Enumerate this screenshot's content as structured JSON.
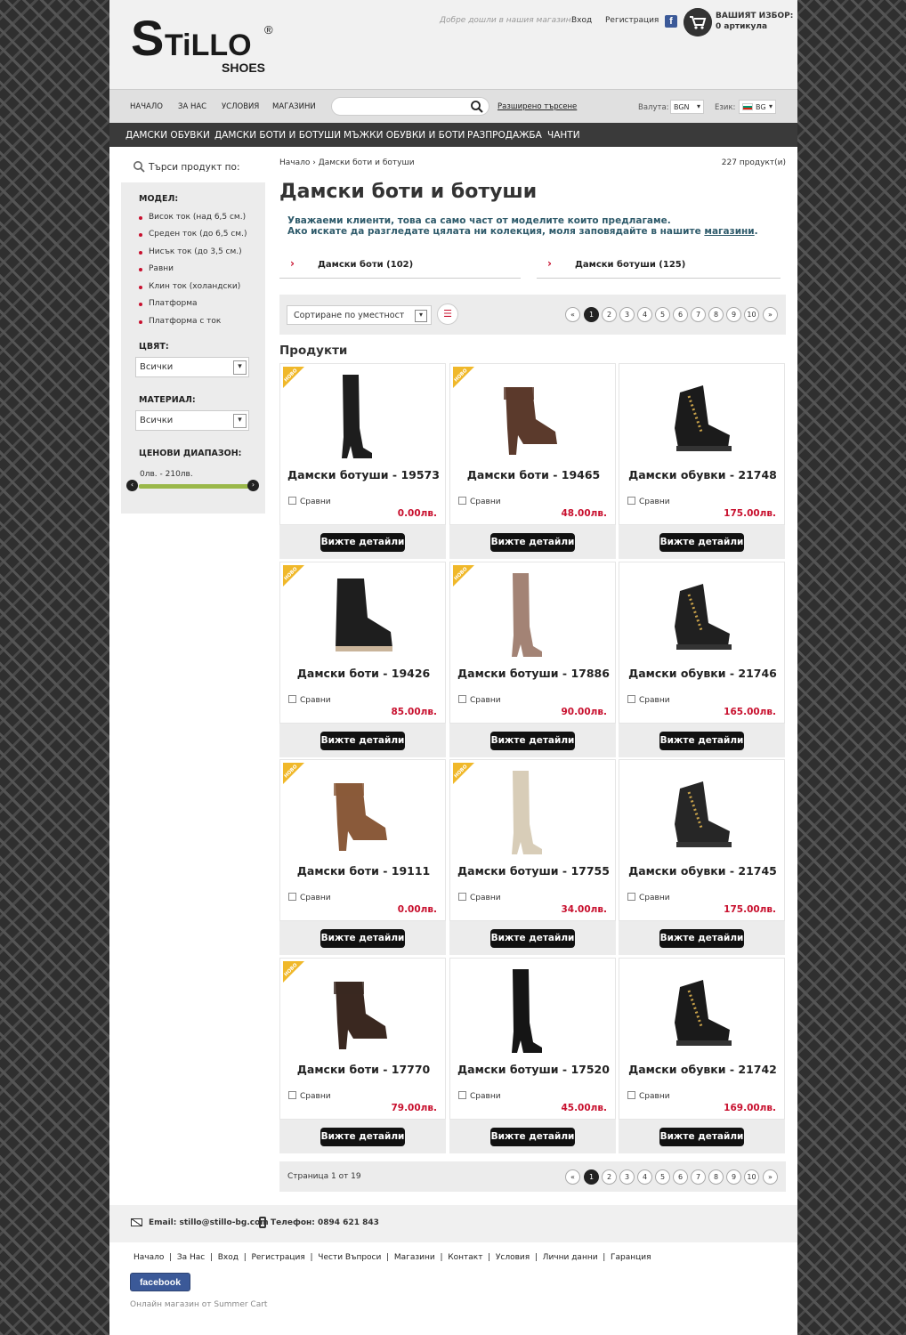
{
  "header": {
    "logo_main": "STiLLO",
    "logo_reg": "®",
    "logo_sub": "SHOES",
    "welcome": "Добре дошли в нашия магазин!",
    "login": "Вход",
    "register": "Регистрация",
    "facebook_letter": "f",
    "cart_title": "ВАШИЯТ ИЗБОР:",
    "cart_count": "0 артикула"
  },
  "nav": {
    "items": [
      "НАЧАЛО",
      "ЗА НАС",
      "УСЛОВИЯ",
      "МАГАЗИНИ"
    ],
    "search_placeholder": "",
    "advanced_search": "Разширено търсене",
    "currency_label": "Валута:",
    "currency_value": "BGN",
    "language_label": "Език:",
    "language_value": "BG"
  },
  "categories": [
    "ДАМСКИ ОБУВКИ",
    "ДАМСКИ БОТИ И БОТУШИ",
    "МЪЖКИ ОБУВКИ И БОТИ",
    "РАЗПРОДАЖБА",
    "ЧАНТИ"
  ],
  "sidebar": {
    "title": "Търси продукт по:",
    "model_label": "МОДЕЛ:",
    "models": [
      "Висок ток (над 6,5 см.)",
      "Среден ток (до 6,5 см.)",
      "Нисък ток (до 3,5 см.)",
      "Равни",
      "Клин ток (холандски)",
      "Платформа",
      "Платформа с ток"
    ],
    "color_label": "ЦВЯТ:",
    "color_value": "Всички",
    "material_label": "МАТЕРИАЛ:",
    "material_value": "Всички",
    "price_label": "ЦЕНОВИ ДИАПАЗОН:",
    "price_range": "0лв. - 210лв."
  },
  "main": {
    "breadcrumb": "Начало › Дамски боти и ботуши",
    "product_count": "227 продукт(и)",
    "title": "Дамски боти и ботуши",
    "intro_line1": "Уважаеми клиенти, това са само част от моделите които предлагаме.",
    "intro_line2": "Ако искате да разгледате цялата ни колекция, моля заповядайте в нашите ",
    "intro_link": "магазини",
    "intro_end": ".",
    "subcats": [
      "Дамски боти (102)",
      "Дамски ботуши (125)"
    ],
    "sort": "Сортиране по уместност",
    "pages": [
      "«",
      "1",
      "2",
      "3",
      "4",
      "5",
      "6",
      "7",
      "8",
      "9",
      "10",
      "»"
    ],
    "current_page": "1",
    "products_heading": "Продукти",
    "page_info": "Страница 1 от 19",
    "compare": "Сравни",
    "details": "Вижте детайли",
    "new_badge": "НОВО"
  },
  "products": [
    {
      "name": "Дамски ботуши - 19573",
      "price": "0.00лв.",
      "isNew": true,
      "shape": "tall",
      "color": "#1d1d1d"
    },
    {
      "name": "Дамски боти - 19465",
      "price": "48.00лв.",
      "isNew": true,
      "shape": "ankle",
      "color": "#5b3a2c"
    },
    {
      "name": "Дамски обувки - 21748",
      "price": "175.00лв.",
      "isNew": false,
      "shape": "sneaker",
      "color": "#1b1b1b"
    },
    {
      "name": "Дамски боти - 19426",
      "price": "85.00лв.",
      "isNew": true,
      "shape": "biker",
      "color": "#1e1e1e"
    },
    {
      "name": "Дамски ботуши - 17886",
      "price": "90.00лв.",
      "isNew": true,
      "shape": "tall",
      "color": "#a38375"
    },
    {
      "name": "Дамски обувки - 21746",
      "price": "165.00лв.",
      "isNew": false,
      "shape": "sneaker",
      "color": "#202020"
    },
    {
      "name": "Дамски боти - 19111",
      "price": "0.00лв.",
      "isNew": true,
      "shape": "ankle",
      "color": "#8a5a3a"
    },
    {
      "name": "Дамски ботуши - 17755",
      "price": "34.00лв.",
      "isNew": true,
      "shape": "tall",
      "color": "#d8cdb8"
    },
    {
      "name": "Дамски обувки - 21745",
      "price": "175.00лв.",
      "isNew": false,
      "shape": "sneaker",
      "color": "#262626"
    },
    {
      "name": "Дамски боти - 17770",
      "price": "79.00лв.",
      "isNew": true,
      "shape": "ankle",
      "color": "#3a2820"
    },
    {
      "name": "Дамски ботуши - 17520",
      "price": "45.00лв.",
      "isNew": false,
      "shape": "tall",
      "color": "#151515"
    },
    {
      "name": "Дамски обувки - 21742",
      "price": "169.00лв.",
      "isNew": false,
      "shape": "sneaker",
      "color": "#1a1a1a"
    }
  ],
  "footer": {
    "email": "Email: stillo@stillo-bg.com",
    "phone": "Телефон: 0894 621 843",
    "links": [
      "Начало",
      "За Нас",
      "Вход",
      "Регистрация",
      "Чести Въпроси",
      "Магазини",
      "Контакт",
      "Условия",
      "Лични данни",
      "Гаранция"
    ],
    "facebook": "facebook",
    "powered": "Онлайн магазин от Summer Cart"
  }
}
